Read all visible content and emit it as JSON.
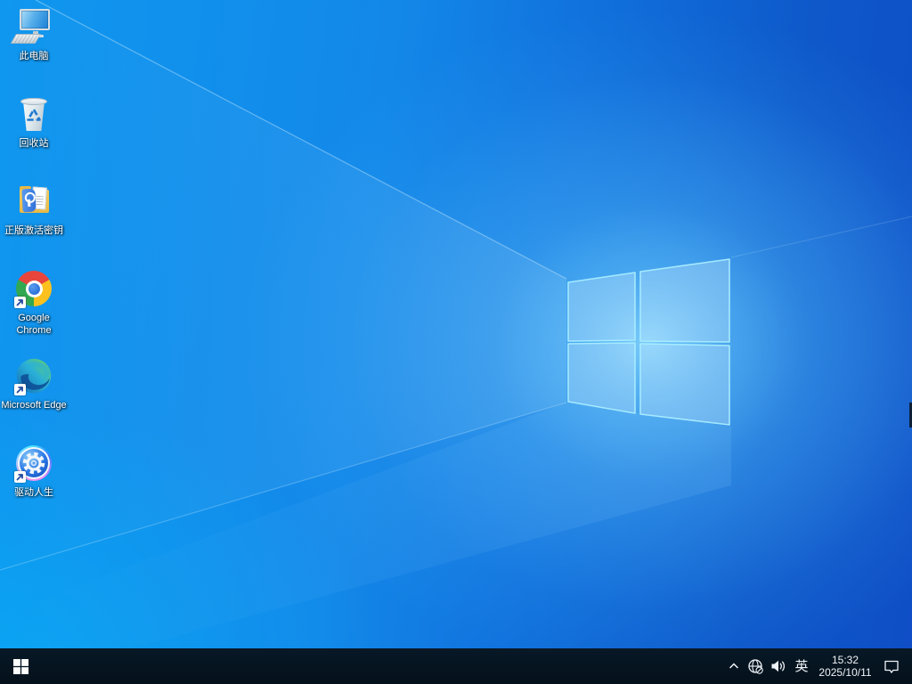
{
  "desktop": {
    "icons": [
      {
        "id": "this-pc",
        "label": "此电脑"
      },
      {
        "id": "recycle-bin",
        "label": "回收站"
      },
      {
        "id": "activation-key-folder",
        "label": "正版激活密钥"
      },
      {
        "id": "google-chrome",
        "label": "Google Chrome"
      },
      {
        "id": "microsoft-edge",
        "label": "Microsoft Edge"
      },
      {
        "id": "driver-genius",
        "label": "驱动人生"
      }
    ]
  },
  "taskbar": {
    "tray": {
      "ime": "英",
      "time": "15:32",
      "date": "2025/10/11"
    }
  },
  "colors": {
    "taskbar_bg": "#05121d",
    "wallpaper_left": "#0f97ef",
    "wallpaper_right": "#0f4ec6",
    "wallpaper_glow": "#7fd4ff",
    "logo_border": "#a9ecff"
  }
}
